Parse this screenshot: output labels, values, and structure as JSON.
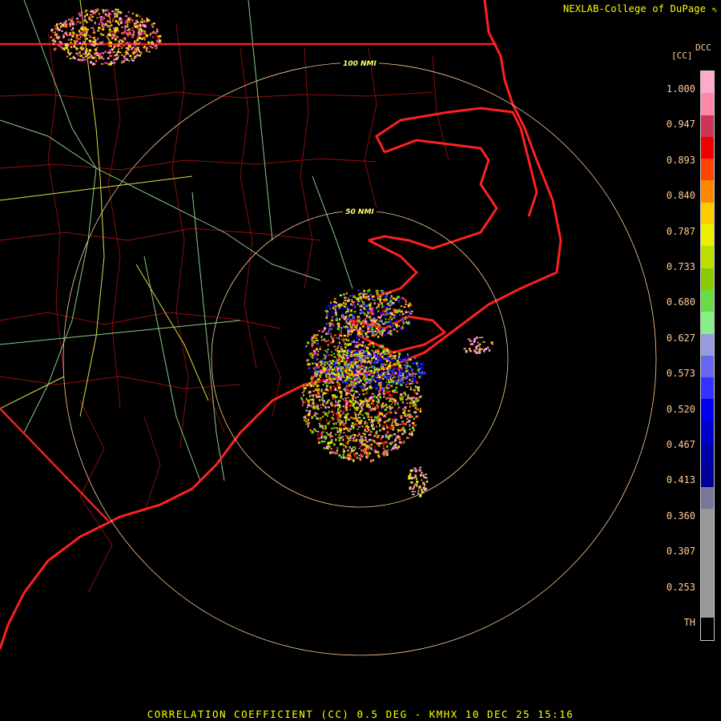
{
  "header": {
    "credit": "NEXLAB-College of DuPage ⇖"
  },
  "footer": {
    "caption": "CORRELATION COEFFICIENT (CC) 0.5 DEG - KMHX 10 DEC 25 15:16"
  },
  "legend": {
    "product_code": "DCC",
    "unit": "[CC]",
    "ticks": [
      "1.000",
      "0.947",
      "0.893",
      "0.840",
      "0.787",
      "0.733",
      "0.680",
      "0.627",
      "0.573",
      "0.520",
      "0.467",
      "0.413",
      "0.360",
      "0.307",
      "0.253",
      "TH"
    ],
    "colors": [
      "#ffaacc",
      "#ff88aa",
      "#cc3355",
      "#ee0000",
      "#ff4400",
      "#ff8800",
      "#ffcc00",
      "#eeee00",
      "#bbdd00",
      "#88cc00",
      "#66dd44",
      "#88ee88",
      "#9999dd",
      "#6666ee",
      "#3333ff",
      "#0000ee",
      "#0000cc",
      "#0000aa",
      "#000099",
      "#777799",
      "#999999",
      "#999999",
      "#999999",
      "#999999",
      "#999999",
      "#000000"
    ]
  },
  "rings": [
    {
      "label": "50 NMI"
    },
    {
      "label": "100 NMI"
    }
  ],
  "map_colors": {
    "state_lines": "#ee2222",
    "coastline": "#ff2020",
    "county_lines": "#aa1111",
    "highways_green": "#88cc88",
    "highways_yellow": "#dddd44",
    "range_rings": "#ffcc99"
  }
}
